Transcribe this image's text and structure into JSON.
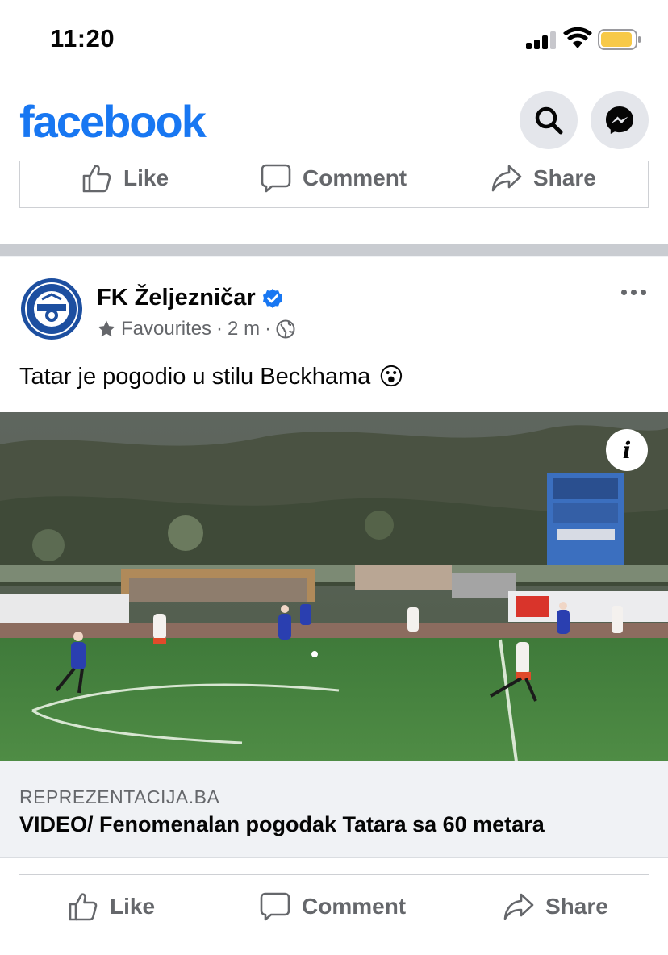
{
  "status_bar": {
    "time": "11:20",
    "icons": [
      "cellular-signal-icon",
      "wifi-icon",
      "battery-icon"
    ],
    "battery_color": "#f7c948"
  },
  "header": {
    "logo_text": "facebook",
    "brand_color": "#1877f2",
    "buttons": [
      "search-icon",
      "messenger-icon"
    ]
  },
  "previous_post_actions": {
    "like_label": "Like",
    "comment_label": "Comment",
    "share_label": "Share"
  },
  "post": {
    "page_name": "FK Željezničar",
    "verified": true,
    "meta_star": "star-icon",
    "meta_label": "Favourites",
    "meta_separator_1": "·",
    "meta_time": "2 m",
    "meta_separator_2": "·",
    "meta_audience_icon": "globe-icon",
    "text": "Tatar je pogodio u stilu Beckhama",
    "emoji": "😮",
    "media": {
      "type": "video-thumbnail",
      "description_icon": "info-icon"
    },
    "link": {
      "domain": "REPREZENTACIJA.BA",
      "title": "VIDEO/ Fenomenalan pogodak Tatara sa 60 metara"
    },
    "actions": {
      "like_label": "Like",
      "comment_label": "Comment",
      "share_label": "Share"
    }
  }
}
